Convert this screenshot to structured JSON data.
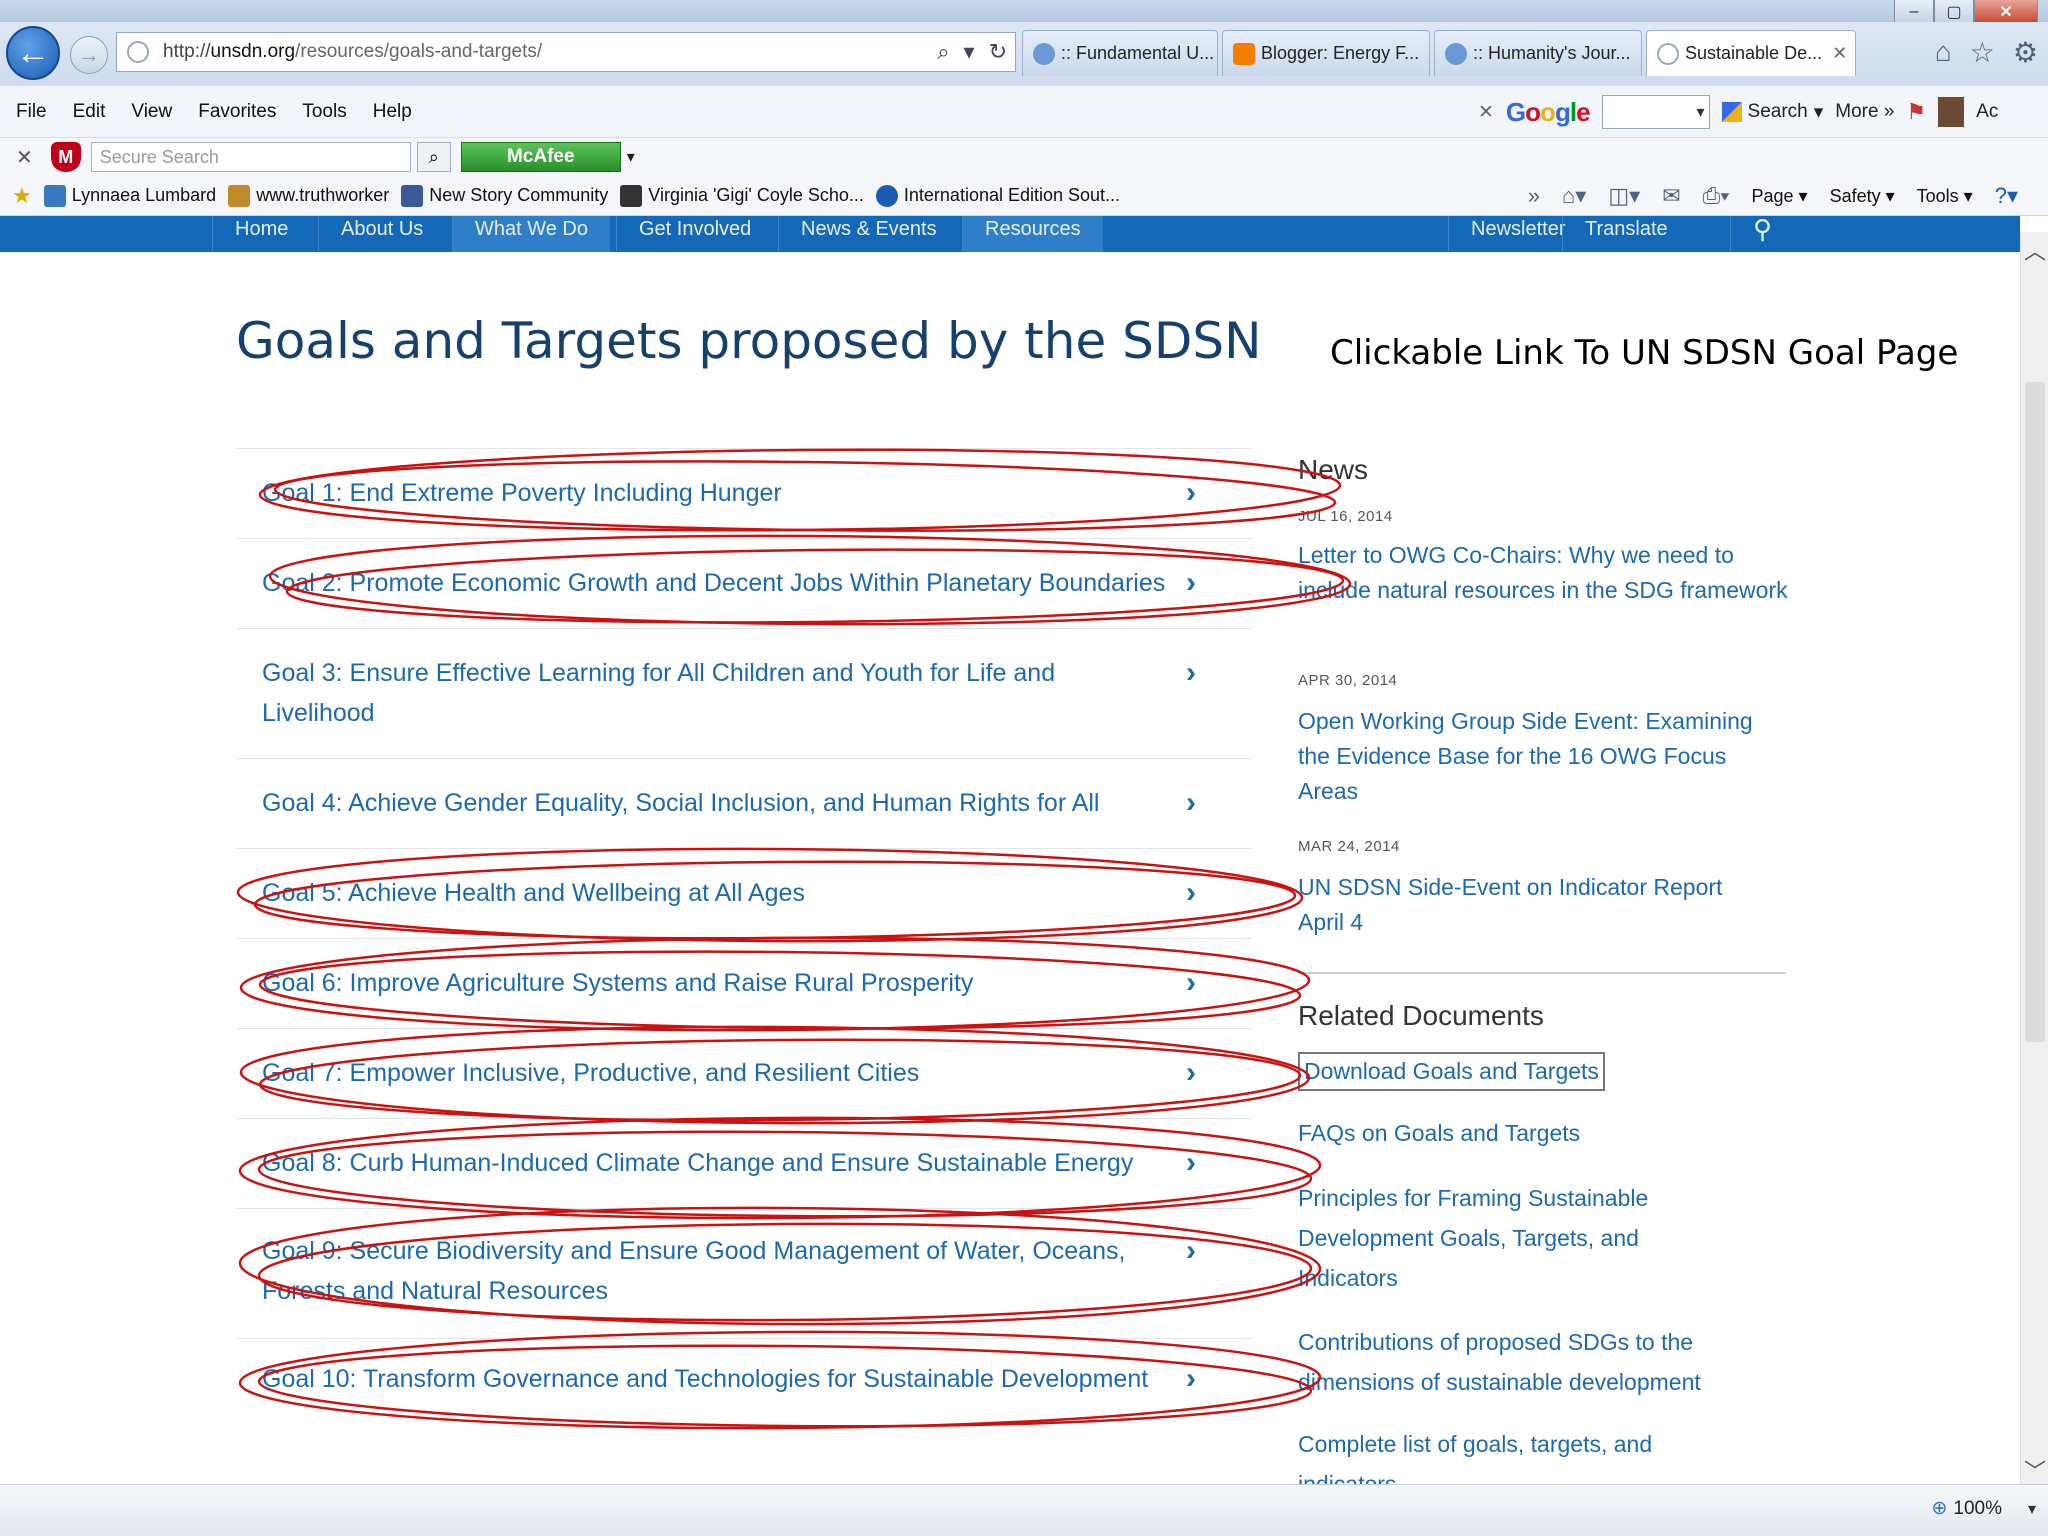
{
  "browser": {
    "window_controls": [
      "–",
      "▢",
      "✕"
    ],
    "address": {
      "prefix": "http://",
      "host": "unsdn.org",
      "path": "/resources/goals-and-targets/"
    },
    "tabs": [
      {
        "label": ":: Fundamental U...",
        "icon_color": "#6a9ad6"
      },
      {
        "label": "Blogger: Energy F...",
        "icon_color": "#f57d00"
      },
      {
        "label": ":: Humanity's Jour...",
        "icon_color": "#6a9ad6"
      },
      {
        "label": "Sustainable De...",
        "icon_color": "#ffffff",
        "close": "✕"
      }
    ],
    "menu": [
      "File",
      "Edit",
      "View",
      "Favorites",
      "Tools",
      "Help"
    ],
    "google": {
      "search_label": "Search",
      "more_label": "More »",
      "trailing": "Ac"
    },
    "secure_search_placeholder": "Secure Search",
    "mcafee_label": "McAfee",
    "favorites": [
      {
        "label": "Lynnaea Lumbard",
        "icon_color": "#3a78c2"
      },
      {
        "label": "www.truthworker",
        "icon_color": "#c28a2a"
      },
      {
        "label": "New Story Community",
        "icon_color": "#3b5998"
      },
      {
        "label": "Virginia 'Gigi' Coyle  Scho...",
        "icon_color": "#333333"
      },
      {
        "label": "International Edition  Sout...",
        "icon_color": "#1a5bb4"
      }
    ],
    "command_bar": {
      "page": "Page",
      "safety": "Safety",
      "tools": "Tools"
    },
    "zoom": "100%"
  },
  "site": {
    "nav": [
      "Home",
      "About Us",
      "What We Do",
      "Get Involved",
      "News & Events",
      "Resources",
      "Newsletter",
      "Translate"
    ],
    "title": "Goals and Targets proposed by the SDSN",
    "annotation": "Clickable Link To UN SDSN Goal Page",
    "goals": [
      "Goal 1: End Extreme Poverty Including Hunger",
      "Goal 2: Promote Economic Growth and Decent Jobs Within Planetary Boundaries",
      "Goal 3: Ensure Effective Learning for All Children and Youth for Life and Livelihood",
      "Goal 4: Achieve Gender Equality, Social Inclusion, and Human Rights for All",
      "Goal 5: Achieve Health and Wellbeing at All Ages",
      "Goal 6: Improve Agriculture Systems and Raise Rural Prosperity",
      "Goal 7: Empower Inclusive, Productive, and Resilient Cities",
      "Goal 8: Curb Human-Induced Climate Change and Ensure Sustainable Energy",
      "Goal 9: Secure Biodiversity and Ensure Good Management of Water, Oceans, Forests and Natural Resources",
      "Goal 10: Transform Governance and Technologies for Sustainable Development"
    ],
    "goal_chevron": "›",
    "news": {
      "heading": "News",
      "items": [
        {
          "date": "JUL 16, 2014",
          "title": "Letter to OWG Co-Chairs: Why we need to include natural resources in the SDG framework"
        },
        {
          "date": "APR 30, 2014",
          "title": "Open Working Group Side Event: Examining the Evidence Base for the 16 OWG Focus Areas"
        },
        {
          "date": "MAR 24, 2014",
          "title": "UN SDSN Side-Event on Indicator Report April 4"
        }
      ]
    },
    "related": {
      "heading": "Related Documents",
      "items": [
        "Download Goals and Targets",
        "FAQs on Goals and Targets",
        "Principles for Framing Sustainable Development Goals, Targets, and Indicators",
        "Contributions of proposed SDGs to the dimensions of sustainable development",
        "Complete list of goals, targets, and indicators"
      ]
    }
  },
  "colors": {
    "link": "#1d69b0",
    "title": "#16406e",
    "nav_bg": "#1468b8",
    "annotation_ellipse": "#cc1111"
  }
}
